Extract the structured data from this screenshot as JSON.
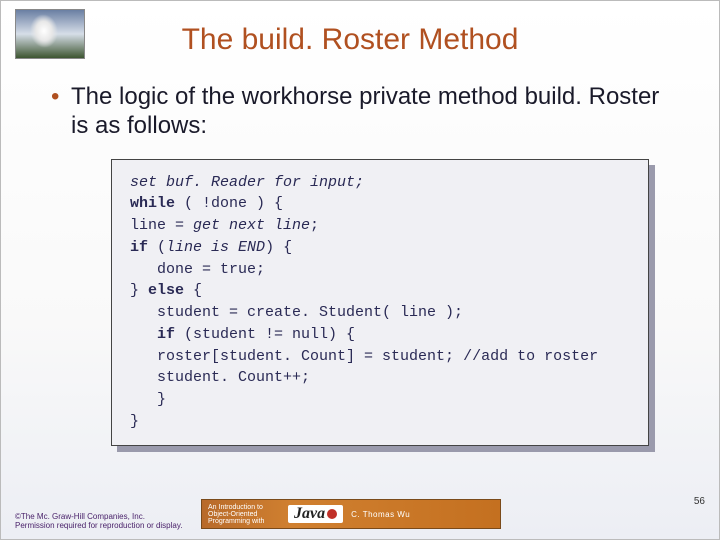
{
  "title": "The build. Roster Method",
  "bullet_text": "The logic of the workhorse private method build. Roster is as follows:",
  "code": {
    "l1_it": "set buf. Reader for input;",
    "l2_kw": "while",
    "l2_rest": " ( !done ) {",
    "l3a": "line = ",
    "l3_it": "get next line",
    "l3b": ";",
    "l4_kw": "if",
    "l4a": " (",
    "l4_it": "line is END",
    "l4b": ") {",
    "l5": "   done = true;",
    "l6a": "} ",
    "l6_kw": "else",
    "l6b": " {",
    "l7": "   student = create. Student( line );",
    "l8_kw": "   if",
    "l8_rest": " (student != null) {",
    "l9a": "   roster[student. Count] = student; ",
    "l9_cm": "//add to roster",
    "l10": "   student. Count++;",
    "l11": "   }",
    "l12": "}"
  },
  "footer": {
    "copyright": "©The Mc. Graw-Hill Companies, Inc. Permission required for reproduction or display.",
    "book_tagline1": "An Introduction to",
    "book_tagline2": "Object-Oriented",
    "book_tagline3": "Programming with",
    "book_title": "Java",
    "book_author": "C. Thomas Wu"
  },
  "page_number": "56"
}
